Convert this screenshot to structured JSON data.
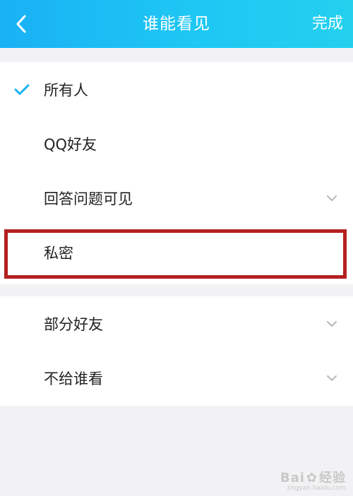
{
  "header": {
    "title": "谁能看见",
    "done_label": "完成"
  },
  "options": [
    {
      "label": "所有人",
      "selected": true,
      "expandable": false
    },
    {
      "label": "QQ好友",
      "selected": false,
      "expandable": false
    },
    {
      "label": "回答问题可见",
      "selected": false,
      "expandable": true
    },
    {
      "label": "私密",
      "selected": false,
      "expandable": false
    },
    {
      "label": "部分好友",
      "selected": false,
      "expandable": true
    },
    {
      "label": "不给谁看",
      "selected": false,
      "expandable": true
    }
  ],
  "watermark": {
    "brand_left": "Bai",
    "brand_right": "经验",
    "sub": "jingyan.baidu.com"
  },
  "colors": {
    "header_start": "#19b1f4",
    "header_end": "#22d0ee",
    "check": "#1ab3f0",
    "highlight": "#b32020"
  }
}
